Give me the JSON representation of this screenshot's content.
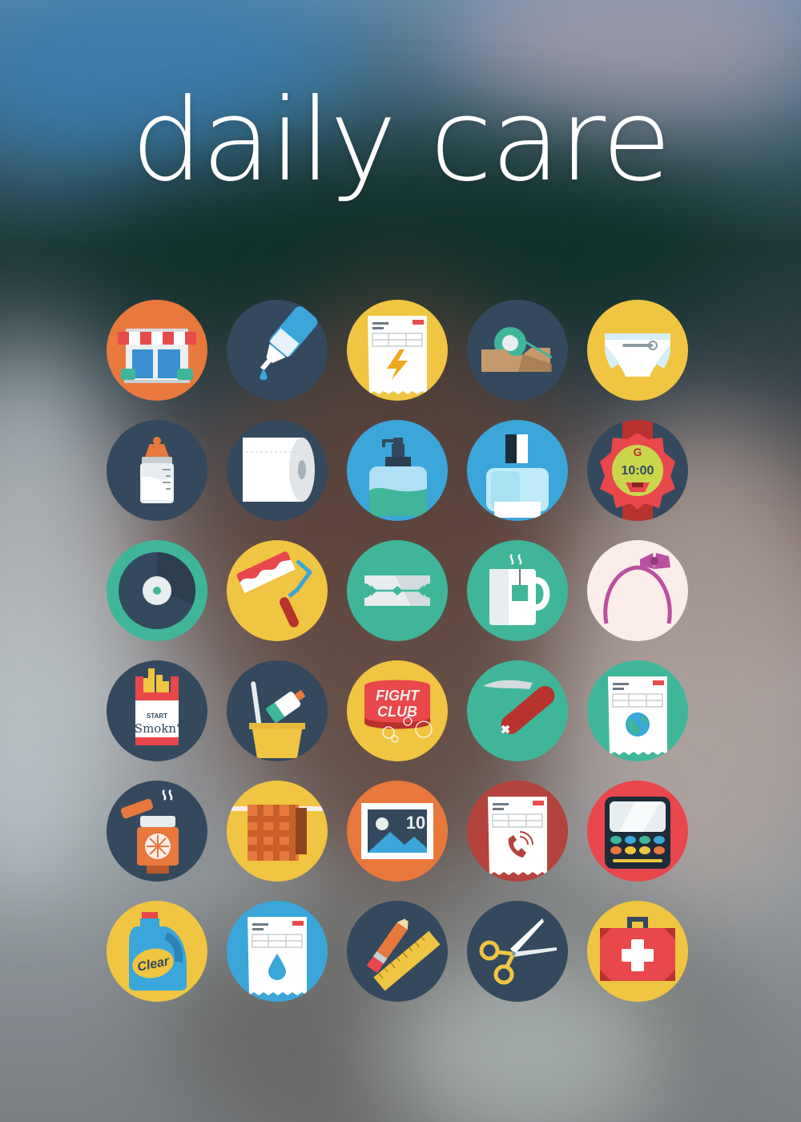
{
  "title": "daily care",
  "colors": {
    "orange": "#E8783C",
    "navy": "#34495E",
    "yellow": "#F0C541",
    "blue": "#3AA6DA",
    "teal": "#3FB69A",
    "pink": "#FBEDEA",
    "red": "#E8474C",
    "brick": "#B4433C"
  },
  "icons": [
    {
      "name": "shop-icon",
      "bg": "orange"
    },
    {
      "name": "eye-dropper-icon",
      "bg": "navy"
    },
    {
      "name": "electricity-bill-icon",
      "bg": "yellow"
    },
    {
      "name": "tape-dispenser-icon",
      "bg": "navy"
    },
    {
      "name": "diaper-icon",
      "bg": "yellow"
    },
    {
      "name": "baby-bottle-icon",
      "bg": "navy"
    },
    {
      "name": "toilet-paper-icon",
      "bg": "navy"
    },
    {
      "name": "soap-dispenser-icon",
      "bg": "blue"
    },
    {
      "name": "perfume-bottle-icon",
      "bg": "blue"
    },
    {
      "name": "wrist-watch-icon",
      "bg": "navy"
    },
    {
      "name": "tape-roll-icon",
      "bg": "teal"
    },
    {
      "name": "paint-roller-icon",
      "bg": "yellow"
    },
    {
      "name": "razor-blade-icon",
      "bg": "teal"
    },
    {
      "name": "tea-mug-icon",
      "bg": "teal"
    },
    {
      "name": "headband-icon",
      "bg": "pink"
    },
    {
      "name": "cigarette-pack-icon",
      "bg": "navy"
    },
    {
      "name": "toothbrush-cup-icon",
      "bg": "navy"
    },
    {
      "name": "soap-bar-icon",
      "bg": "yellow"
    },
    {
      "name": "pocket-knife-icon",
      "bg": "teal"
    },
    {
      "name": "internet-bill-icon",
      "bg": "teal"
    },
    {
      "name": "aroma-lamp-icon",
      "bg": "navy"
    },
    {
      "name": "towel-icon",
      "bg": "yellow"
    },
    {
      "name": "postage-stamp-icon",
      "bg": "orange"
    },
    {
      "name": "phone-bill-icon",
      "bg": "brick"
    },
    {
      "name": "eyeshadow-palette-icon",
      "bg": "red"
    },
    {
      "name": "detergent-bottle-icon",
      "bg": "yellow"
    },
    {
      "name": "water-bill-icon",
      "bg": "blue"
    },
    {
      "name": "pencil-ruler-icon",
      "bg": "navy"
    },
    {
      "name": "scissors-icon",
      "bg": "navy"
    },
    {
      "name": "first-aid-kit-icon",
      "bg": "yellow"
    }
  ],
  "labels": {
    "watch_brand": "G",
    "watch_time": "10:00",
    "cig_top": "START",
    "cig_brand": "Smokn'",
    "soap_line1": "FIGHT",
    "soap_line2": "CLUB",
    "stamp_value": "10",
    "detergent_brand": "Clear"
  }
}
